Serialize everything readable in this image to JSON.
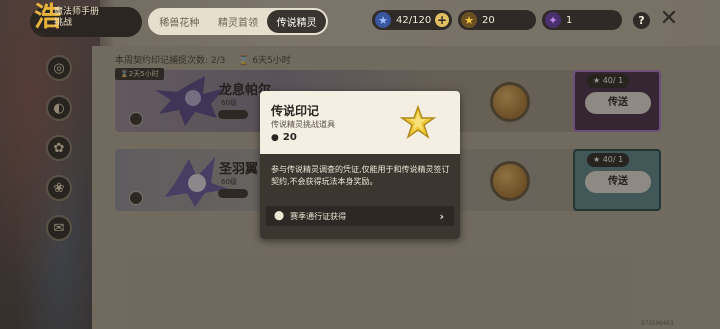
{
  "header": {
    "logo_text_line1": "魔法师手册",
    "logo_text_line2": "挑战",
    "logo_glyph": "浩",
    "tabs": [
      {
        "label": "稀兽花种",
        "active": false
      },
      {
        "label": "精灵首领",
        "active": false
      },
      {
        "label": "传说精灵",
        "active": true
      }
    ],
    "resources": [
      {
        "icon": "blue-star-icon",
        "value": "42/120",
        "has_plus": true
      },
      {
        "icon": "gold-star-icon",
        "value": "20",
        "has_plus": false
      },
      {
        "icon": "purple-star-icon",
        "value": "1",
        "has_plus": false
      }
    ],
    "help_label": "?",
    "close_label": "✕"
  },
  "capture_info": {
    "text": "本周契约印记捕捉次数: 2/3",
    "timer": "6天5小时"
  },
  "cards": [
    {
      "timer": "2天5小时",
      "name": "龙息帕尔",
      "level": "60级",
      "cost": "40/ 1",
      "send": "传送",
      "style": "purple"
    },
    {
      "timer": "",
      "name": "圣羽翼",
      "level": "60级",
      "cost": "40/ 1",
      "send": "传送",
      "style": "teal"
    }
  ],
  "tooltip": {
    "title": "传说印记",
    "subtitle": "传说精灵挑战道具",
    "owned": "20",
    "description": "参与传说精灵调查的凭证,仅能用于和传说精灵签订契约,不会获得玩法本身奖励。",
    "source": "赛季通行证获得"
  },
  "build_id": "973500463",
  "colors": {
    "accent_purple": "#b07ad0",
    "accent_teal": "#5f8a8e",
    "gold": "#e8b43c"
  }
}
